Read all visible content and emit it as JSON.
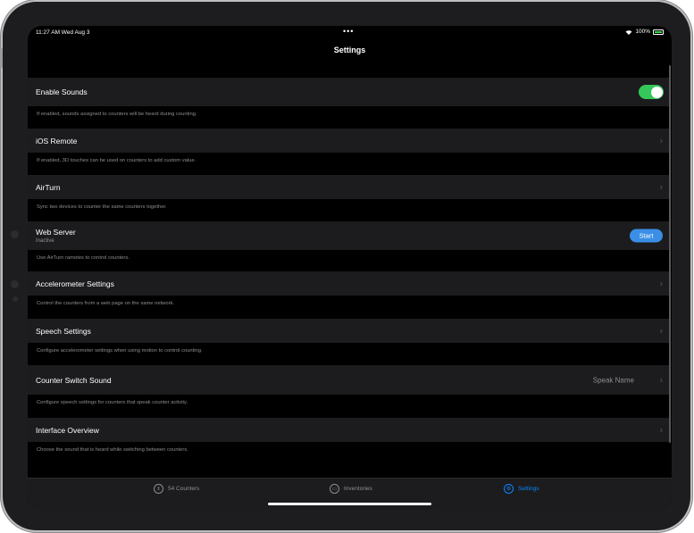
{
  "status_bar": {
    "time": "11:27 AM  Wed Aug 3",
    "dots": "•••",
    "battery_pct": "100%"
  },
  "nav": {
    "title": "Settings"
  },
  "settings": [
    {
      "label": "Enable Sounds",
      "control": "toggle",
      "on": true
    },
    {
      "footer": "If enabled, sounds assigned to counters will be heard during counting."
    },
    {
      "label": "iOS Remote",
      "control": "chevron"
    },
    {
      "footer": "If enabled, 3D touches can be used on counters to add custom value."
    },
    {
      "label": "AirTurn",
      "control": "chevron"
    },
    {
      "footer": "Sync two devices to counter the same counters together."
    },
    {
      "label": "Web Server",
      "subtitle": "Inactive",
      "control": "button",
      "button_label": "Start"
    },
    {
      "footer": "Use AirTurn ramotes to control counters."
    },
    {
      "label": "Accelerometer Settings",
      "control": "chevron"
    },
    {
      "footer": "Control the counters from a web page on the same network."
    },
    {
      "label": "Speech Settings",
      "control": "chevron"
    },
    {
      "footer": "Configure accelerometer settings when using motion to control counting."
    },
    {
      "label": "Counter Switch Sound",
      "detail": "Speak Name",
      "control": "chevron"
    },
    {
      "footer": "Configure speech settings for counters that speak counter activity."
    },
    {
      "label": "Interface Overview",
      "control": "chevron"
    },
    {
      "footer": "Choose the sound that is heard while switching between counters."
    }
  ],
  "tabs": [
    {
      "label": "54 Counters",
      "icon": "plus-minus-icon",
      "active": false
    },
    {
      "label": "Inventories",
      "icon": "box-icon",
      "active": false
    },
    {
      "label": "Settings",
      "icon": "gear-icon",
      "active": true
    }
  ],
  "colors": {
    "accent": "#0a84ff",
    "toggle_on": "#34c759",
    "start_button": "#3a8ee6",
    "cell_bg": "#1c1c1e"
  }
}
